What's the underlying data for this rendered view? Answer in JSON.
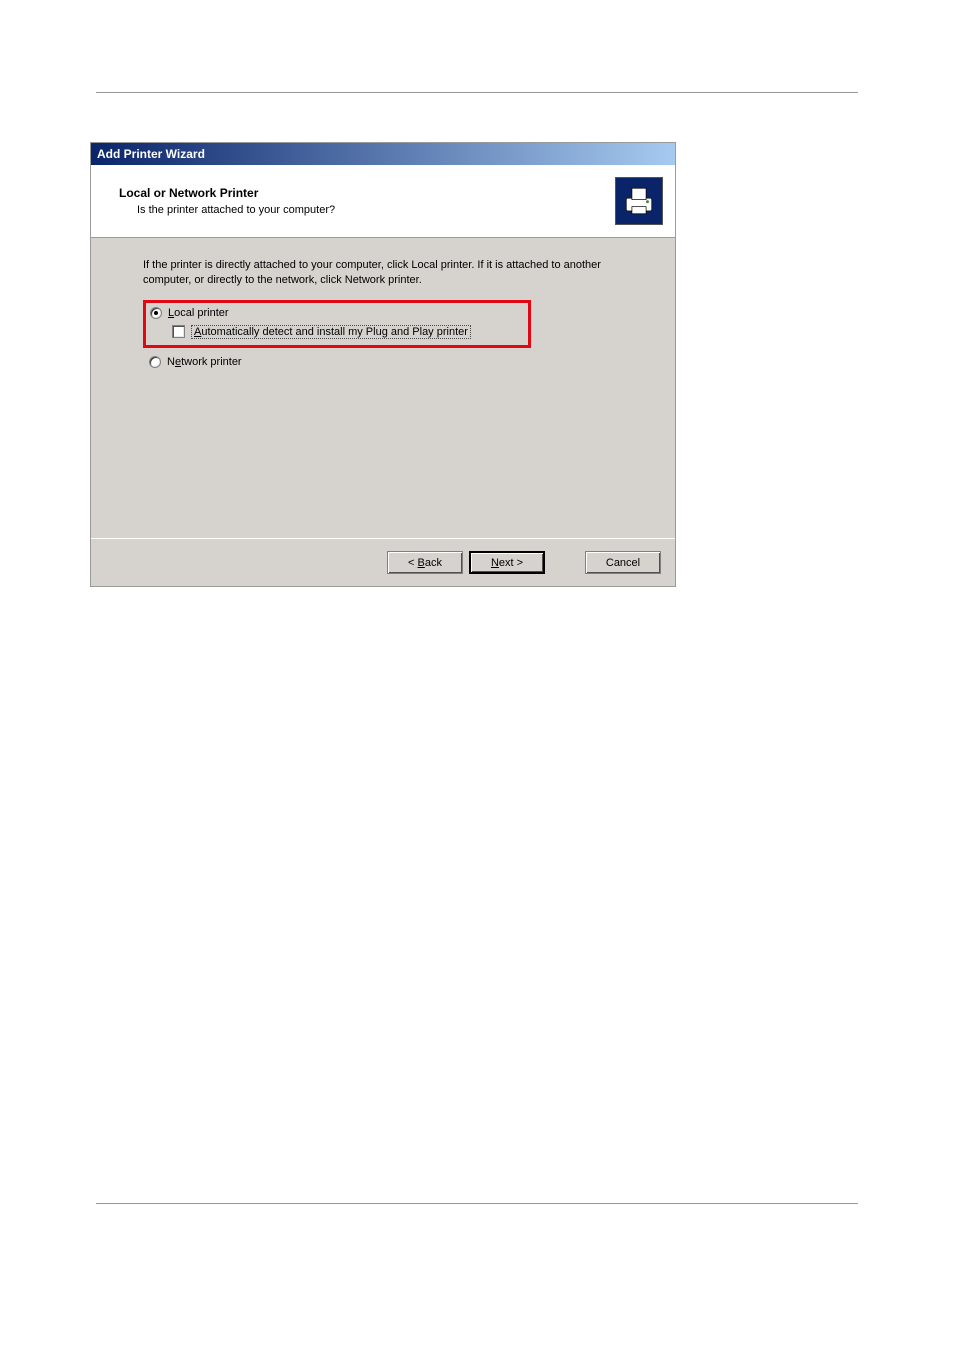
{
  "dialog": {
    "title": "Add Printer Wizard"
  },
  "header": {
    "title": "Local or Network Printer",
    "subtitle": "Is the printer attached to your computer?",
    "icon": "printer-icon"
  },
  "body": {
    "instruction": "If the printer is directly attached to your computer, click Local printer.  If it is attached to another computer, or directly to the network, click Network printer.",
    "options": {
      "local": {
        "prefix": "",
        "accel": "L",
        "label": "ocal printer",
        "selected": true
      },
      "autodetect": {
        "prefix": "",
        "accel": "A",
        "label": "utomatically detect and install my Plug and Play printer",
        "checked": false
      },
      "network": {
        "prefix": "N",
        "accel": "e",
        "label": "twork printer",
        "selected": false
      }
    }
  },
  "footer": {
    "back": {
      "prefix": "< ",
      "accel": "B",
      "label": "ack"
    },
    "next": {
      "prefix": "",
      "accel": "N",
      "label": "ext >"
    },
    "cancel": {
      "label": "Cancel"
    }
  }
}
